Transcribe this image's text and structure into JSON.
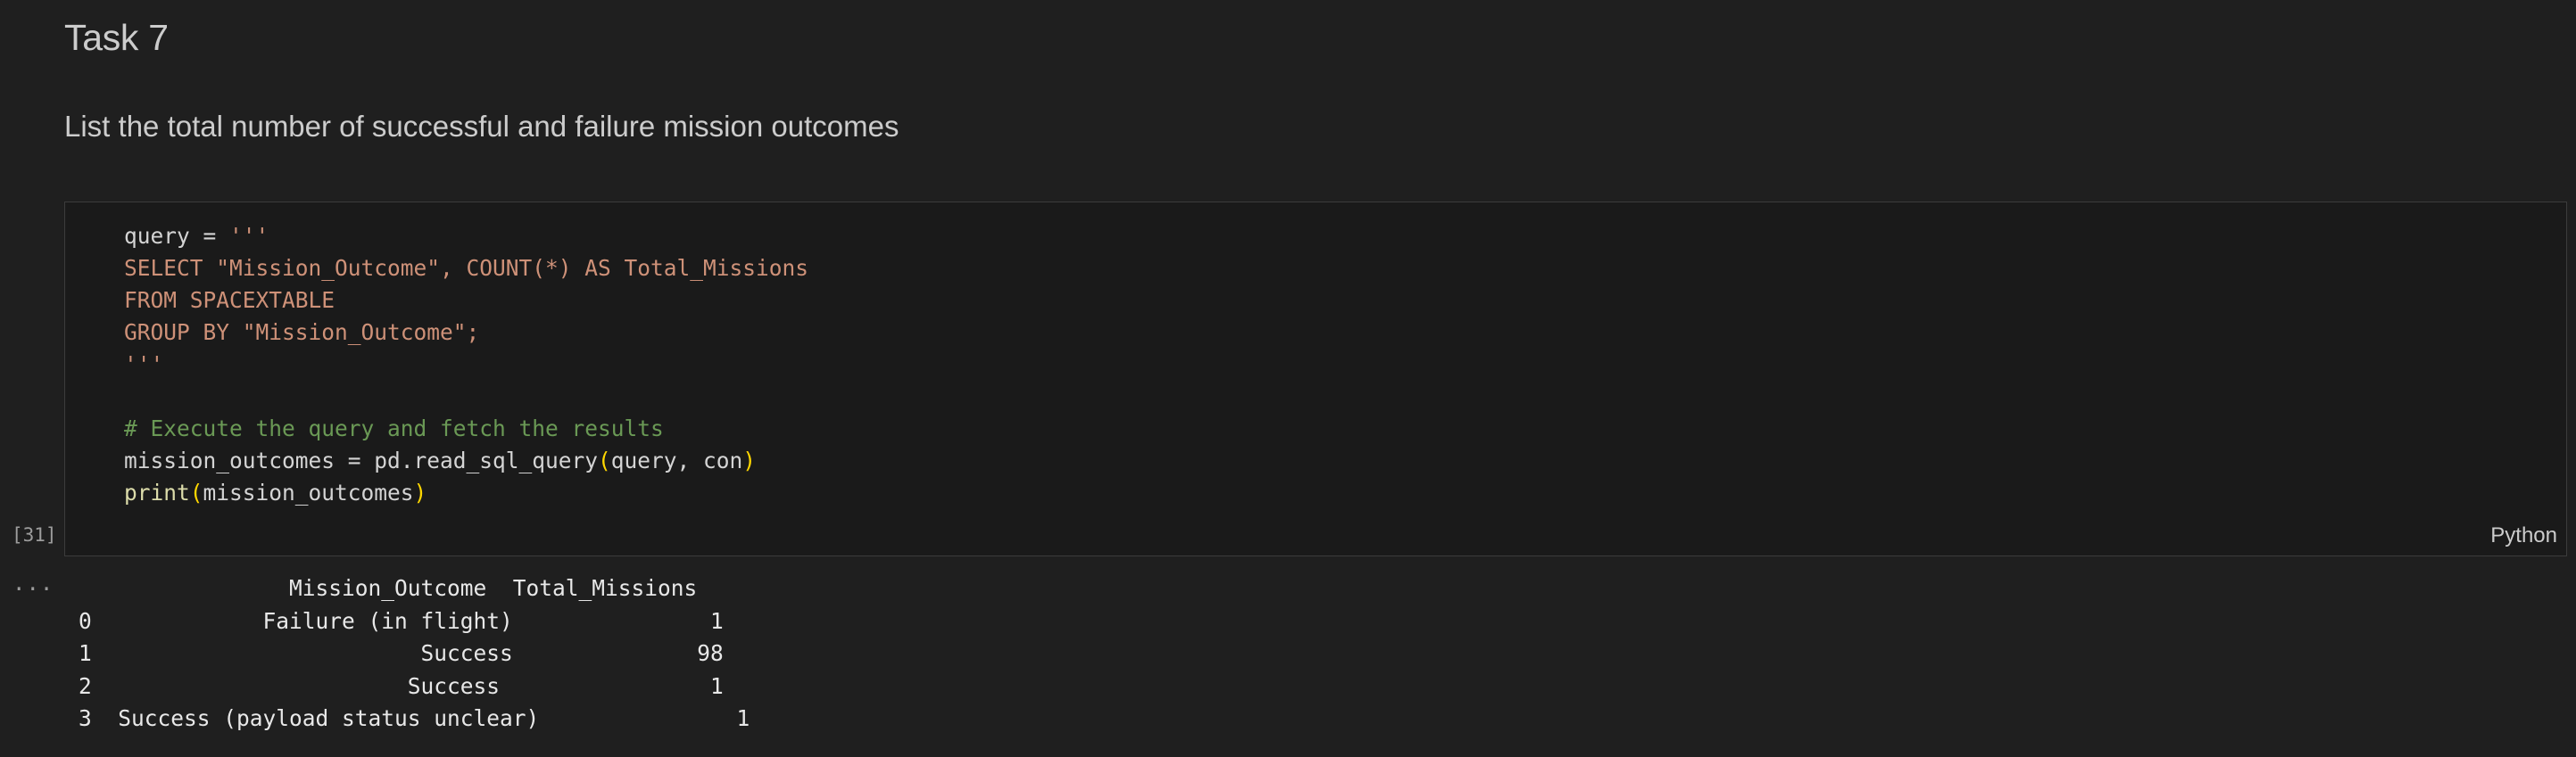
{
  "heading": "Task 7",
  "subtitle": "List the total number of successful and failure mission outcomes",
  "cell": {
    "execution_count": "[31]",
    "language": "Python",
    "code_lines": [
      [
        {
          "t": "query = ",
          "c": "plain"
        },
        {
          "t": "'''",
          "c": "str"
        }
      ],
      [
        {
          "t": "SELECT \"Mission_Outcome\", COUNT(*) AS Total_Missions",
          "c": "str"
        }
      ],
      [
        {
          "t": "FROM SPACEXTABLE",
          "c": "str"
        }
      ],
      [
        {
          "t": "GROUP BY \"Mission_Outcome\";",
          "c": "str"
        }
      ],
      [
        {
          "t": "'''",
          "c": "str"
        }
      ],
      [],
      [
        {
          "t": "# Execute the query and fetch the results",
          "c": "com"
        }
      ],
      [
        {
          "t": "mission_outcomes = pd.read_sql_query",
          "c": "plain"
        },
        {
          "t": "(",
          "c": "paren"
        },
        {
          "t": "query, con",
          "c": "plain"
        },
        {
          "t": ")",
          "c": "paren"
        }
      ],
      [
        {
          "t": "print",
          "c": "fn"
        },
        {
          "t": "(",
          "c": "paren"
        },
        {
          "t": "mission_outcomes",
          "c": "plain"
        },
        {
          "t": ")",
          "c": "paren"
        }
      ]
    ]
  },
  "output": {
    "ellipsis": "...",
    "lines": [
      "                Mission_Outcome  Total_Missions",
      "0             Failure (in flight)               1",
      "1                         Success              98",
      "2                        Success                1",
      "3  Success (payload status unclear)               1"
    ]
  }
}
